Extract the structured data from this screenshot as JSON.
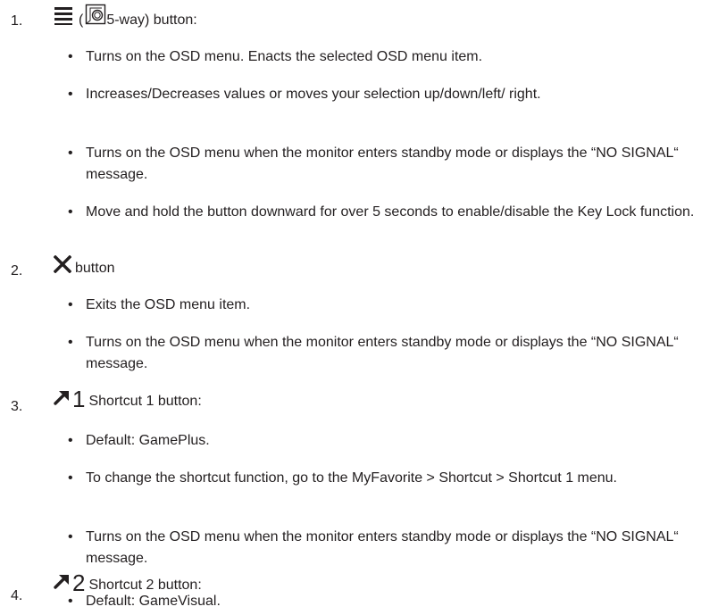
{
  "items": [
    {
      "number": "1.",
      "open_paren": "(",
      "title": " 5-way) button:",
      "icons": [
        "menu-lines-icon",
        "five-way-joystick-icon"
      ],
      "bullets": [
        "Turns on the OSD menu. Enacts the selected OSD menu item.",
        "Increases/Decreases values or moves your selection up/down/left/ right.",
        "Turns on the OSD menu when the monitor enters standby mode or displays the “NO SIGNAL“ message.",
        "Move and hold the button downward for over 5 seconds to enable/disable the Key Lock function."
      ]
    },
    {
      "number": "2.",
      "title": "button",
      "icons": [
        "close-x-icon"
      ],
      "bullets": [
        "Exits the OSD menu item.",
        "Turns on the OSD menu when the monitor enters standby mode or displays the “NO SIGNAL“ message."
      ]
    },
    {
      "number": "3.",
      "icon_digit": "1",
      "title": "Shortcut 1 button:",
      "icons": [
        "shortcut-arrow-icon"
      ],
      "bullets": [
        "Default: GamePlus.",
        "To change the shortcut function, go to the MyFavorite > Shortcut > Shortcut 1 menu.",
        "Turns on the OSD menu when the monitor enters standby mode or displays the “NO SIGNAL“ message."
      ]
    },
    {
      "number": "4.",
      "icon_digit": "2",
      "title": "Shortcut 2 button:",
      "icons": [
        "shortcut-arrow-icon"
      ],
      "bullets": [
        "Default: GameVisual."
      ]
    }
  ]
}
